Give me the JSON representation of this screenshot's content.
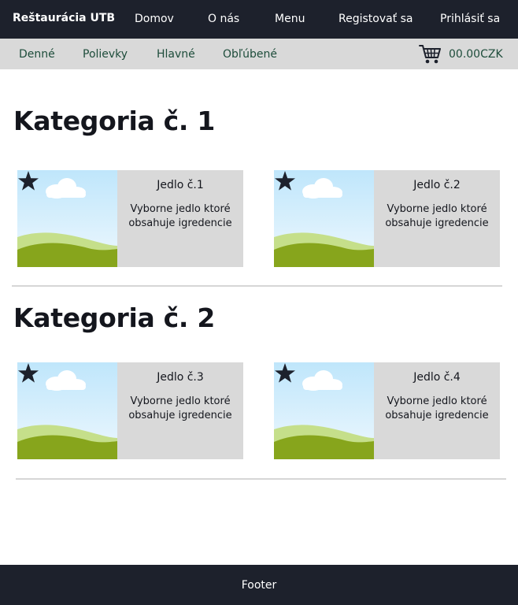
{
  "nav": {
    "brand": "Reštaurácia UTB",
    "links": [
      "Domov",
      "O nás",
      "Menu",
      "Registovať sa",
      "Prihlásiť sa"
    ]
  },
  "subnav": {
    "links": [
      "Denné",
      "Polievky",
      "Hlavné",
      "Obľúbené"
    ],
    "cart_total": "00.00CZK"
  },
  "categories": [
    {
      "title": "Kategoria č. 1",
      "items": [
        {
          "title": "Jedlo č.1",
          "description": "Vyborne jedlo ktoré obsahuje igredencie"
        },
        {
          "title": "Jedlo č.2",
          "description": "Vyborne jedlo ktoré obsahuje igredencie"
        }
      ]
    },
    {
      "title": "Kategoria č. 2",
      "items": [
        {
          "title": "Jedlo č.3",
          "description": "Vyborne jedlo ktoré obsahuje igredencie"
        },
        {
          "title": "Jedlo č.4",
          "description": "Vyborne jedlo ktoré obsahuje igredencie"
        }
      ]
    }
  ],
  "footer": {
    "text": "Footer"
  },
  "colors": {
    "header_bg": "#1d212c",
    "subbar_bg": "#d9d9d9",
    "subnav_text": "#1e4d3b",
    "card_bg": "#d9d9d9"
  },
  "icons": {
    "cart": "shopping-cart-icon",
    "favorite": "star-icon",
    "image_placeholder": "landscape-image"
  }
}
